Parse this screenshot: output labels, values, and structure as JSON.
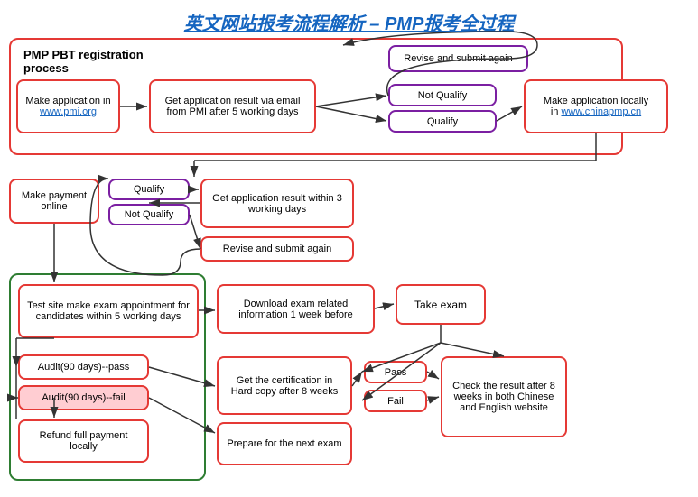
{
  "title": "英文网站报考流程解析 – PMP报考全过程",
  "boxes": {
    "pmp_pbt_label": "PMP PBT registration process",
    "make_application": "Make application in\nwww.pmi.org",
    "get_result_email": "Get application result via email\nfrom PMI after 5 working days",
    "revise_submit": "Revise and submit again",
    "not_qualify_1": "Not Qualify",
    "qualify_1": "Qualify",
    "make_payment": "Make payment\nonline",
    "qualify_2": "Qualify",
    "not_qualify_2": "Not Qualify",
    "get_result_3days": "Get application result\nwithin 3 working days",
    "make_application_local": "Make application locally\nin www.chinapmp.cn",
    "revise_submit_2": "Revise and submit again",
    "test_site": "Test site make exam appointment for\ncandidates within 5 working days",
    "download_exam": "Download exam related\ninformation 1 week before",
    "take_exam": "Take exam",
    "audit_pass": "Audit(90 days)--pass",
    "audit_fail": "Audit(90 days)--fail",
    "certification": "Get the certification\nin Hard copy after 8\nweeks",
    "pass": "Pass",
    "fail": "Fail",
    "refund": "Refund full payment\nlocally",
    "next_exam": "Prepare for the next\nexam",
    "check_result": "Check the result\nafter 8 weeks in\nboth Chinese and\nEnglish website"
  },
  "colors": {
    "red": "#e53935",
    "blue": "#1565C0",
    "purple": "#7b1fa2",
    "green": "#2e7d32",
    "arrow": "#333"
  }
}
